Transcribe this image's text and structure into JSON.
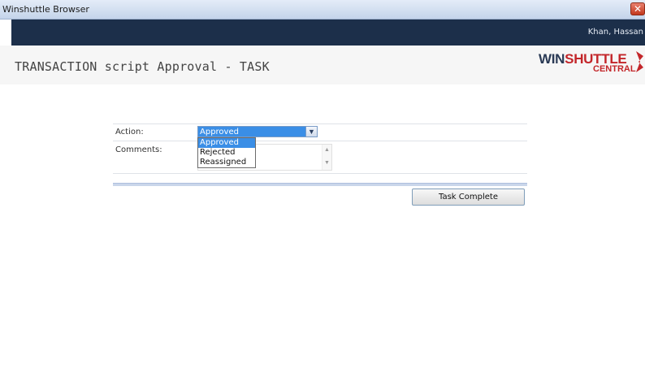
{
  "window": {
    "title": "Winshuttle Browser",
    "close_glyph": "✕"
  },
  "user": {
    "name": "Khan, Hassan"
  },
  "header": {
    "title": "TRANSACTION script Approval - TASK",
    "logo": {
      "wordmark_a": "WIN",
      "wordmark_b": "SHUTTLE",
      "sub": "CENTRAL"
    }
  },
  "form": {
    "action": {
      "label": "Action:",
      "selected": "Approved",
      "options": [
        "Approved",
        "Rejected",
        "Reassigned"
      ]
    },
    "comments": {
      "label": "Comments:",
      "value": ""
    },
    "submit_label": "Task Complete"
  },
  "icons": {
    "close": "close-icon",
    "dropdown": "chevron-down-icon",
    "scroll_up": "scroll-up-icon",
    "scroll_down": "scroll-down-icon"
  },
  "colors": {
    "selection": "#3a8ee6",
    "topbar": "#1c2f4a",
    "brand_red": "#c3262a",
    "brand_navy": "#2a3a55"
  }
}
